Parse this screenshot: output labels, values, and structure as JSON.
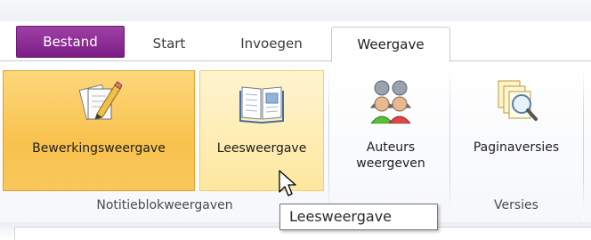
{
  "tabs": {
    "file": "Bestand",
    "start": "Start",
    "insert": "Invoegen",
    "view": "Weergave"
  },
  "groups": {
    "notebook_views": {
      "label": "Notitieblokweergaven",
      "buttons": {
        "edit_view": "Bewerkingsweergave",
        "read_view": "Leesweergave"
      }
    },
    "authors": {
      "button_line1": "Auteurs",
      "button_line2": "weergeven"
    },
    "versions": {
      "label": "Versies",
      "button": "Paginaversies"
    }
  },
  "tooltip": "Leesweergave",
  "icons": {
    "edit_view": "pencil-pages-icon",
    "read_view": "open-book-icon",
    "authors": "people-icon",
    "page_versions": "magnify-pages-icon"
  },
  "colors": {
    "file_tab": "#7b1e86",
    "active_button": "#f9c24d",
    "hover_button": "#fde79f"
  }
}
